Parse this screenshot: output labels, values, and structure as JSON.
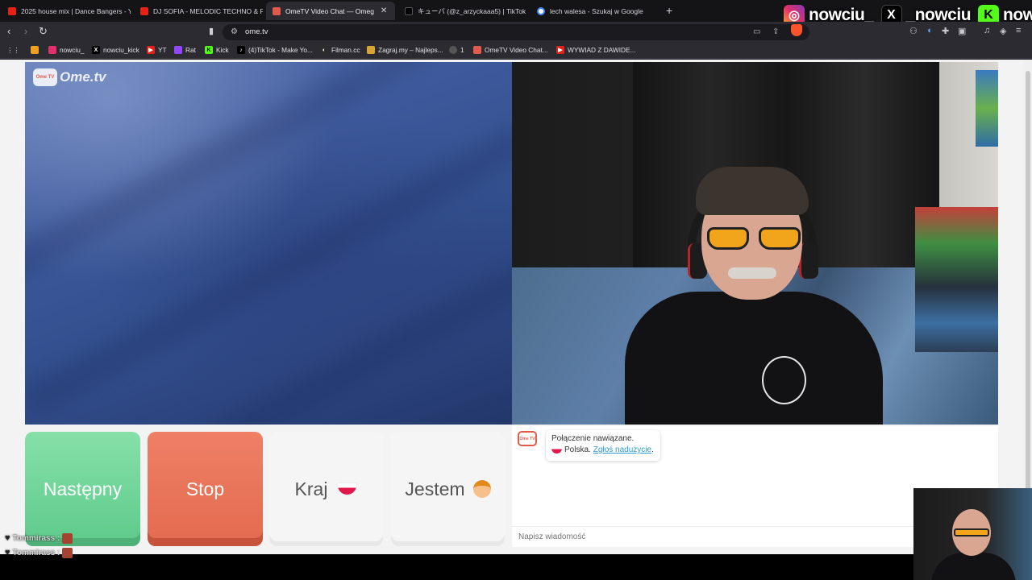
{
  "tabs": [
    {
      "label": "2025 house mix | Dance Bangers - Yo",
      "color": "#e62117"
    },
    {
      "label": "DJ SOFIA - MELODIC TECHNO & FU",
      "color": "#e62117"
    },
    {
      "label": "OmeTV Video Chat — Omeg",
      "color": "#e05b4a",
      "active": true
    },
    {
      "label": "キューバ (@z_arzyckaaa5) | TikTok",
      "color": "#000000"
    },
    {
      "label": "lech walesa - Szukaj w Google",
      "color": "#4285f4"
    }
  ],
  "new_tab": "+",
  "social": [
    {
      "icon": "instagram-icon",
      "name": "nowciu_"
    },
    {
      "icon": "x-icon",
      "name": "_nowciu"
    },
    {
      "icon": "kick-icon",
      "name": "nowciu"
    }
  ],
  "address": {
    "url": "ome.tv"
  },
  "bookmarks": [
    {
      "label": "nowciu_",
      "icon": "instagram-icon"
    },
    {
      "label": "nowciu_kick",
      "icon": "x-icon"
    },
    {
      "label": "YT",
      "icon": "youtube-icon"
    },
    {
      "label": "Rat",
      "icon": "twitch-icon"
    },
    {
      "label": "Kick",
      "icon": "kick-icon"
    },
    {
      "label": "(4)TikTok - Make Yo...",
      "icon": "tiktok-icon"
    },
    {
      "label": "Filman.cc",
      "icon": "filman-icon"
    },
    {
      "label": "Zagraj.my – Najleps...",
      "icon": "zagraj-icon"
    },
    {
      "label": "1",
      "icon": "globe-icon"
    },
    {
      "label": "OmeTV Video Chat...",
      "icon": "ometv-icon"
    },
    {
      "label": "WYWIAD Z DAWIDE...",
      "icon": "youtube-icon"
    }
  ],
  "ometv": {
    "logo_text": "Ome.tv",
    "logo_badge": "Ome TV",
    "buttons": {
      "next": "Następny",
      "stop": "Stop",
      "country": "Kraj",
      "gender": "Jestem"
    },
    "chat": {
      "status": "Połączenie nawiązane.",
      "country": "Polska.",
      "report": "Zgłoś nadużycie",
      "report_suffix": ".",
      "placeholder": "Napisz wiadomość"
    }
  },
  "viewers": [
    {
      "name": "Tommirass :"
    },
    {
      "name": "Tommirass :"
    }
  ],
  "colors": {
    "next": "#5dca8a",
    "stop": "#e36a4f",
    "link": "#2e9bd1",
    "ometv": "#e05b4a"
  }
}
